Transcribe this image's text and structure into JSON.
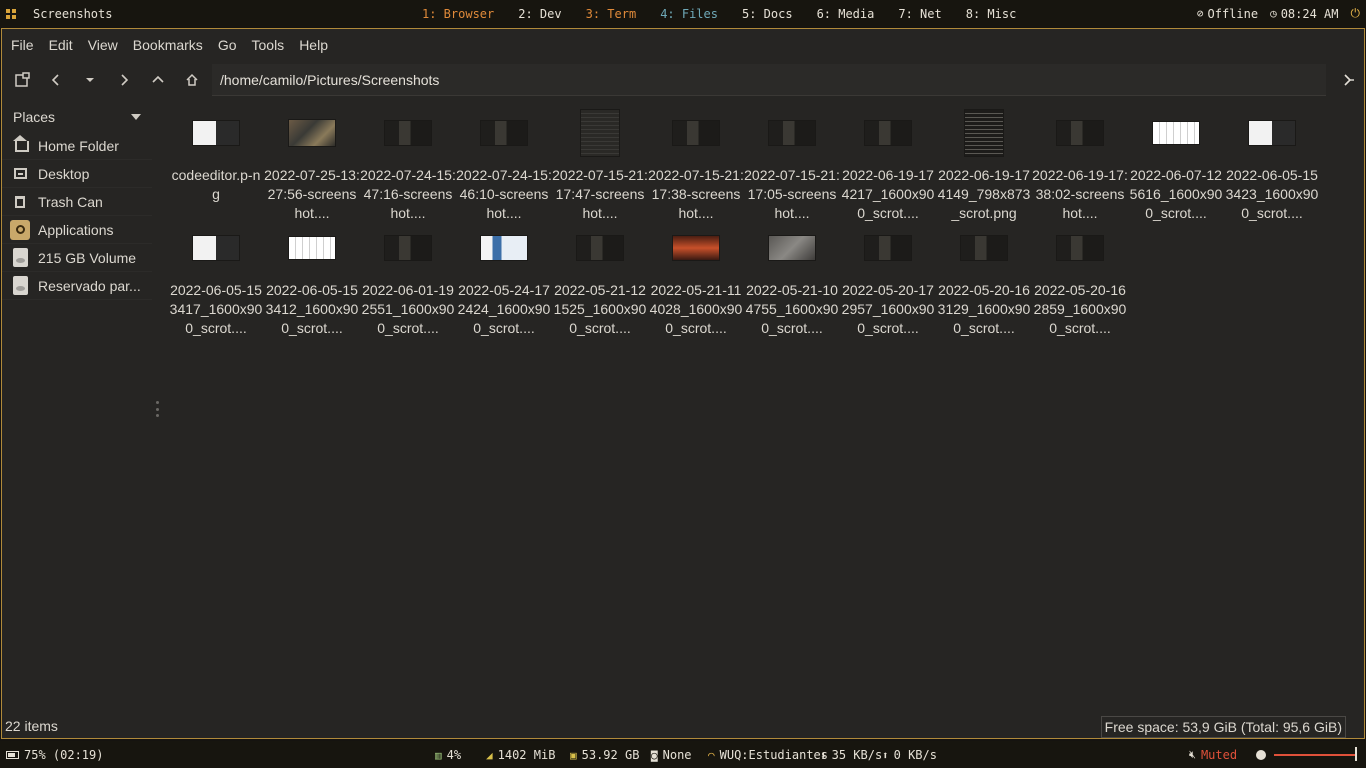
{
  "topbar": {
    "title": "Screenshots",
    "workspaces": [
      "1: Browser",
      "2: Dev",
      "3: Term",
      "4: Files",
      "5: Docs",
      "6: Media",
      "7: Net",
      "8: Misc"
    ],
    "network_status": "Offline",
    "clock": "08:24 AM"
  },
  "menu": [
    "File",
    "Edit",
    "View",
    "Bookmarks",
    "Go",
    "Tools",
    "Help"
  ],
  "path": "/home/camilo/Pictures/Screenshots",
  "sidebar": {
    "header": "Places",
    "items": [
      {
        "label": "Home Folder",
        "icon": "home-icon"
      },
      {
        "label": "Desktop",
        "icon": "desktop-icon"
      },
      {
        "label": "Trash Can",
        "icon": "trash-icon"
      },
      {
        "label": "Applications",
        "icon": "applications-icon"
      },
      {
        "label": "215 GB Volume",
        "icon": "drive-icon"
      },
      {
        "label": "Reservado par...",
        "icon": "drive-icon"
      }
    ]
  },
  "files": [
    {
      "name": "codeeditor.p-ng",
      "thumb": "light"
    },
    {
      "name": "2022-07-25-13:27:56-screenshot....",
      "thumb": "photo"
    },
    {
      "name": "2022-07-24-15:47:16-screenshot....",
      "thumb": "dark"
    },
    {
      "name": "2022-07-24-15:46:10-screenshot....",
      "thumb": "dark"
    },
    {
      "name": "2022-07-15-21:17:47-screenshot....",
      "thumb": "tall"
    },
    {
      "name": "2022-07-15-21:17:38-screenshot....",
      "thumb": "dark"
    },
    {
      "name": "2022-07-15-21:17:05-screenshot....",
      "thumb": "dark"
    },
    {
      "name": "2022-06-19-174217_1600x900_scrot....",
      "thumb": "dark"
    },
    {
      "name": "2022-06-19-174149_798x873_scrot.png",
      "thumb": "tall-dark"
    },
    {
      "name": "2022-06-19-17:38:02-screenshot....",
      "thumb": "dark"
    },
    {
      "name": "2022-06-07-125616_1600x900_scrot....",
      "thumb": "white"
    },
    {
      "name": "2022-06-05-153423_1600x900_scrot....",
      "thumb": "light"
    },
    {
      "name": "2022-06-05-153417_1600x900_scrot....",
      "thumb": "light"
    },
    {
      "name": "2022-06-05-153412_1600x900_scrot....",
      "thumb": "white"
    },
    {
      "name": "2022-06-01-192551_1600x900_scrot....",
      "thumb": "dark"
    },
    {
      "name": "2022-05-24-172424_1600x900_scrot....",
      "thumb": "blue"
    },
    {
      "name": "2022-05-21-121525_1600x900_scrot....",
      "thumb": "dark"
    },
    {
      "name": "2022-05-21-114028_1600x900_scrot....",
      "thumb": "sunset"
    },
    {
      "name": "2022-05-21-104755_1600x900_scrot....",
      "thumb": "gray"
    },
    {
      "name": "2022-05-20-172957_1600x900_scrot....",
      "thumb": "dark"
    },
    {
      "name": "2022-05-20-163129_1600x900_scrot....",
      "thumb": "dark"
    },
    {
      "name": "2022-05-20-162859_1600x900_scrot....",
      "thumb": "dark"
    }
  ],
  "status": {
    "count": "22 items",
    "free_space": "Free space: 53,9 GiB (Total: 95,6 GiB)"
  },
  "bottombar": {
    "battery": "75% (02:19)",
    "cpu": "4%",
    "memory": "1402 MiB",
    "disk": "53.92 GB",
    "bluetooth": "None",
    "wifi": "WUQ:Estudiantes",
    "download": "35 KB/s",
    "upload": "0 KB/s",
    "volume": "Muted"
  },
  "colors": {
    "accent": "#e08a3a",
    "active_workspace": "#6fa9b8",
    "frame": "#b08a3a",
    "muted": "#e0513a"
  }
}
